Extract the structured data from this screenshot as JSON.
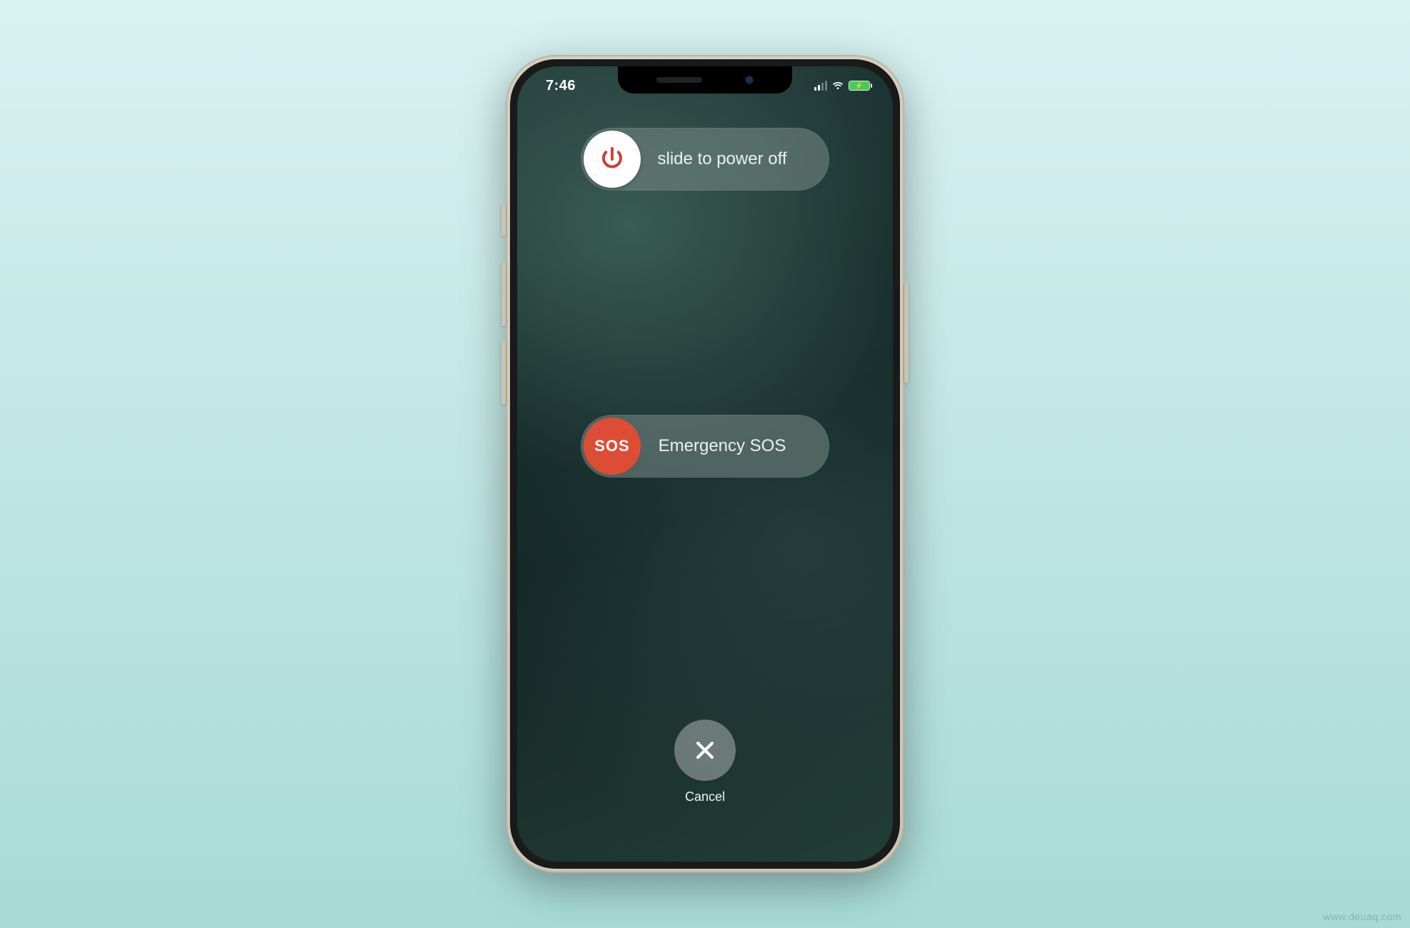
{
  "statusbar": {
    "time": "7:46",
    "signal_active_bars": 2,
    "signal_total_bars": 4,
    "wifi": true,
    "battery_charging": true,
    "battery_color": "#3fcf4a"
  },
  "power_slider": {
    "label": "slide to power off",
    "icon": "power-icon",
    "knob_color": "#ffffff",
    "icon_color": "#d73a2e"
  },
  "sos_slider": {
    "label": "Emergency SOS",
    "knob_text": "SOS",
    "knob_color": "#ea4a30"
  },
  "cancel": {
    "label": "Cancel",
    "icon": "close-icon"
  },
  "watermark": "www.deuaq.com"
}
